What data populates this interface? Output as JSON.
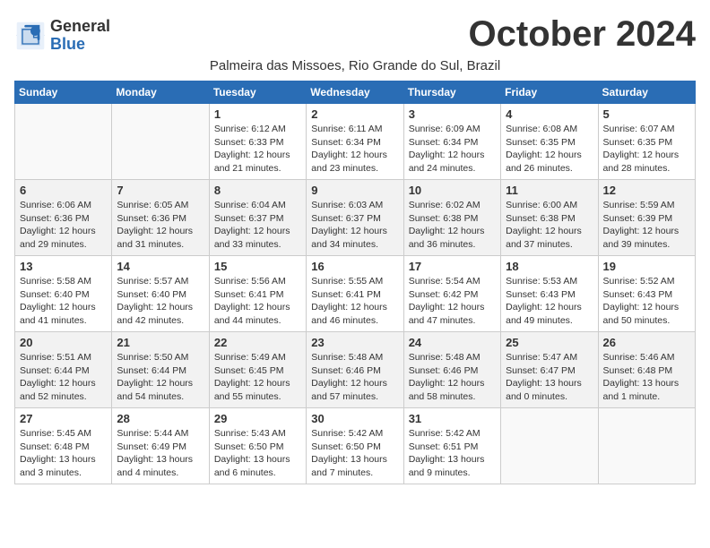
{
  "logo": {
    "general": "General",
    "blue": "Blue"
  },
  "title": "October 2024",
  "subtitle": "Palmeira das Missoes, Rio Grande do Sul, Brazil",
  "weekdays": [
    "Sunday",
    "Monday",
    "Tuesday",
    "Wednesday",
    "Thursday",
    "Friday",
    "Saturday"
  ],
  "weeks": [
    [
      {
        "day": "",
        "info": ""
      },
      {
        "day": "",
        "info": ""
      },
      {
        "day": "1",
        "info": "Sunrise: 6:12 AM\nSunset: 6:33 PM\nDaylight: 12 hours and 21 minutes."
      },
      {
        "day": "2",
        "info": "Sunrise: 6:11 AM\nSunset: 6:34 PM\nDaylight: 12 hours and 23 minutes."
      },
      {
        "day": "3",
        "info": "Sunrise: 6:09 AM\nSunset: 6:34 PM\nDaylight: 12 hours and 24 minutes."
      },
      {
        "day": "4",
        "info": "Sunrise: 6:08 AM\nSunset: 6:35 PM\nDaylight: 12 hours and 26 minutes."
      },
      {
        "day": "5",
        "info": "Sunrise: 6:07 AM\nSunset: 6:35 PM\nDaylight: 12 hours and 28 minutes."
      }
    ],
    [
      {
        "day": "6",
        "info": "Sunrise: 6:06 AM\nSunset: 6:36 PM\nDaylight: 12 hours and 29 minutes."
      },
      {
        "day": "7",
        "info": "Sunrise: 6:05 AM\nSunset: 6:36 PM\nDaylight: 12 hours and 31 minutes."
      },
      {
        "day": "8",
        "info": "Sunrise: 6:04 AM\nSunset: 6:37 PM\nDaylight: 12 hours and 33 minutes."
      },
      {
        "day": "9",
        "info": "Sunrise: 6:03 AM\nSunset: 6:37 PM\nDaylight: 12 hours and 34 minutes."
      },
      {
        "day": "10",
        "info": "Sunrise: 6:02 AM\nSunset: 6:38 PM\nDaylight: 12 hours and 36 minutes."
      },
      {
        "day": "11",
        "info": "Sunrise: 6:00 AM\nSunset: 6:38 PM\nDaylight: 12 hours and 37 minutes."
      },
      {
        "day": "12",
        "info": "Sunrise: 5:59 AM\nSunset: 6:39 PM\nDaylight: 12 hours and 39 minutes."
      }
    ],
    [
      {
        "day": "13",
        "info": "Sunrise: 5:58 AM\nSunset: 6:40 PM\nDaylight: 12 hours and 41 minutes."
      },
      {
        "day": "14",
        "info": "Sunrise: 5:57 AM\nSunset: 6:40 PM\nDaylight: 12 hours and 42 minutes."
      },
      {
        "day": "15",
        "info": "Sunrise: 5:56 AM\nSunset: 6:41 PM\nDaylight: 12 hours and 44 minutes."
      },
      {
        "day": "16",
        "info": "Sunrise: 5:55 AM\nSunset: 6:41 PM\nDaylight: 12 hours and 46 minutes."
      },
      {
        "day": "17",
        "info": "Sunrise: 5:54 AM\nSunset: 6:42 PM\nDaylight: 12 hours and 47 minutes."
      },
      {
        "day": "18",
        "info": "Sunrise: 5:53 AM\nSunset: 6:43 PM\nDaylight: 12 hours and 49 minutes."
      },
      {
        "day": "19",
        "info": "Sunrise: 5:52 AM\nSunset: 6:43 PM\nDaylight: 12 hours and 50 minutes."
      }
    ],
    [
      {
        "day": "20",
        "info": "Sunrise: 5:51 AM\nSunset: 6:44 PM\nDaylight: 12 hours and 52 minutes."
      },
      {
        "day": "21",
        "info": "Sunrise: 5:50 AM\nSunset: 6:44 PM\nDaylight: 12 hours and 54 minutes."
      },
      {
        "day": "22",
        "info": "Sunrise: 5:49 AM\nSunset: 6:45 PM\nDaylight: 12 hours and 55 minutes."
      },
      {
        "day": "23",
        "info": "Sunrise: 5:48 AM\nSunset: 6:46 PM\nDaylight: 12 hours and 57 minutes."
      },
      {
        "day": "24",
        "info": "Sunrise: 5:48 AM\nSunset: 6:46 PM\nDaylight: 12 hours and 58 minutes."
      },
      {
        "day": "25",
        "info": "Sunrise: 5:47 AM\nSunset: 6:47 PM\nDaylight: 13 hours and 0 minutes."
      },
      {
        "day": "26",
        "info": "Sunrise: 5:46 AM\nSunset: 6:48 PM\nDaylight: 13 hours and 1 minute."
      }
    ],
    [
      {
        "day": "27",
        "info": "Sunrise: 5:45 AM\nSunset: 6:48 PM\nDaylight: 13 hours and 3 minutes."
      },
      {
        "day": "28",
        "info": "Sunrise: 5:44 AM\nSunset: 6:49 PM\nDaylight: 13 hours and 4 minutes."
      },
      {
        "day": "29",
        "info": "Sunrise: 5:43 AM\nSunset: 6:50 PM\nDaylight: 13 hours and 6 minutes."
      },
      {
        "day": "30",
        "info": "Sunrise: 5:42 AM\nSunset: 6:50 PM\nDaylight: 13 hours and 7 minutes."
      },
      {
        "day": "31",
        "info": "Sunrise: 5:42 AM\nSunset: 6:51 PM\nDaylight: 13 hours and 9 minutes."
      },
      {
        "day": "",
        "info": ""
      },
      {
        "day": "",
        "info": ""
      }
    ]
  ]
}
